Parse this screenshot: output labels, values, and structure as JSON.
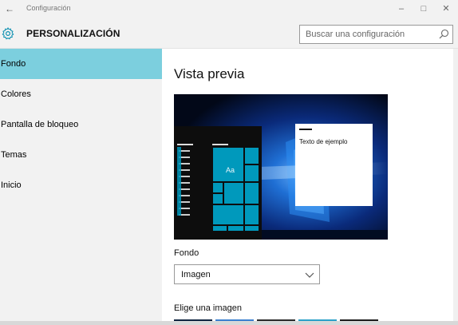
{
  "window": {
    "title": "Configuración",
    "back_icon": "back-arrow-icon",
    "minimize_glyph": "–",
    "maximize_glyph": "□",
    "close_glyph": "✕"
  },
  "header": {
    "icon": "gear-icon",
    "title": "PERSONALIZACIÓN",
    "search_placeholder": "Buscar una configuración"
  },
  "sidebar": {
    "items": [
      {
        "label": "Fondo",
        "active": true
      },
      {
        "label": "Colores",
        "active": false
      },
      {
        "label": "Pantalla de bloqueo",
        "active": false
      },
      {
        "label": "Temas",
        "active": false
      },
      {
        "label": "Inicio",
        "active": false
      }
    ]
  },
  "main": {
    "preview_title": "Vista previa",
    "preview": {
      "tile_text": "Aa",
      "sample_window_text": "Texto de ejemplo"
    },
    "background_label": "Fondo",
    "background_value": "Imagen",
    "choose_image_label": "Elige una imagen"
  },
  "colors": {
    "accent": "#0099bc",
    "nav_selected": "#7ccfde",
    "chrome": "#f2f2f2"
  }
}
